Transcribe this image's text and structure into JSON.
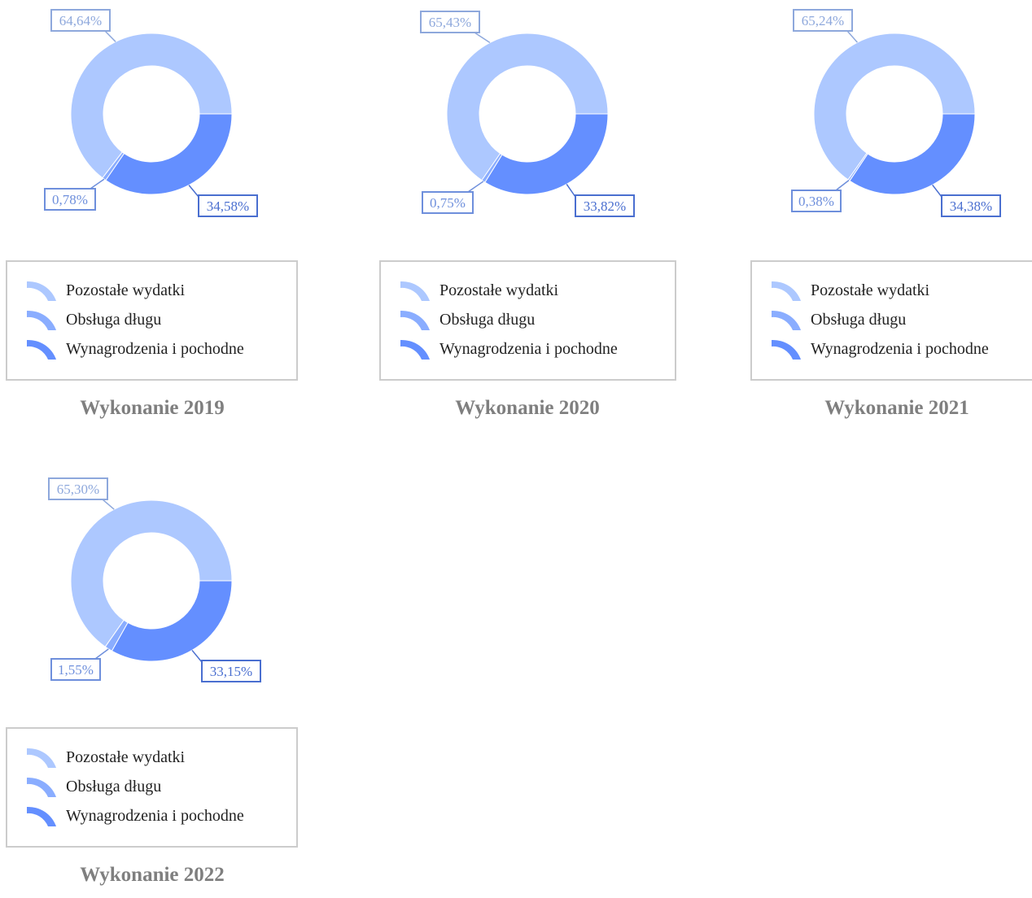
{
  "colors": {
    "pozostale": "#adc8ff",
    "obsluga": "#8aadff",
    "wynagrodzenia": "#648fff",
    "label_light": "#8ea8dc",
    "label_mid": "#6e8fdc",
    "label_dark": "#4a6fd0",
    "title": "#7f7f7f",
    "legend_border": "#cccccc"
  },
  "legend": {
    "items": [
      {
        "label": "Pozostałe wydatki",
        "icon": "arc-light-icon"
      },
      {
        "label": "Obsługa długu",
        "icon": "arc-mid-icon"
      },
      {
        "label": "Wynagrodzenia i pochodne",
        "icon": "arc-dark-icon"
      }
    ]
  },
  "chart_data": [
    {
      "type": "pie",
      "title": "Wykonanie 2019",
      "series": [
        {
          "name": "Pozostałe wydatki",
          "value": 64.64,
          "label": "64,64%"
        },
        {
          "name": "Obsługa długu",
          "value": 0.78,
          "label": "0,78%"
        },
        {
          "name": "Wynagrodzenia i pochodne",
          "value": 34.58,
          "label": "34,58%"
        }
      ]
    },
    {
      "type": "pie",
      "title": "Wykonanie 2020",
      "series": [
        {
          "name": "Pozostałe wydatki",
          "value": 65.43,
          "label": "65,43%"
        },
        {
          "name": "Obsługa długu",
          "value": 0.75,
          "label": "0,75%"
        },
        {
          "name": "Wynagrodzenia i pochodne",
          "value": 33.82,
          "label": "33,82%"
        }
      ]
    },
    {
      "type": "pie",
      "title": "Wykonanie 2021",
      "series": [
        {
          "name": "Pozostałe wydatki",
          "value": 65.24,
          "label": "65,24%"
        },
        {
          "name": "Obsługa długu",
          "value": 0.38,
          "label": "0,38%"
        },
        {
          "name": "Wynagrodzenia i pochodne",
          "value": 34.38,
          "label": "34,38%"
        }
      ]
    },
    {
      "type": "pie",
      "title": "Wykonanie 2022",
      "series": [
        {
          "name": "Pozostałe wydatki",
          "value": 65.3,
          "label": "65,30%"
        },
        {
          "name": "Obsługa długu",
          "value": 1.55,
          "label": "1,55%"
        },
        {
          "name": "Wynagrodzenia i pochodne",
          "value": 33.15,
          "label": "33,15%"
        }
      ]
    }
  ]
}
